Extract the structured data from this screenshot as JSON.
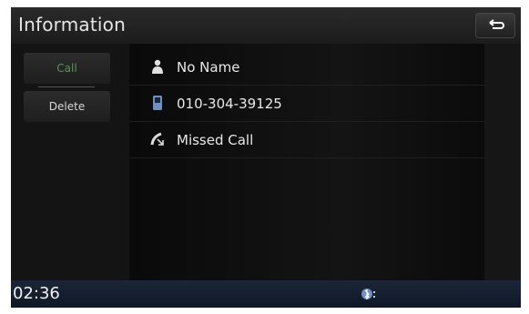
{
  "header": {
    "title": "Information",
    "back_icon": "back-arrow-icon"
  },
  "sidebar": {
    "call_label": "Call",
    "delete_label": "Delete"
  },
  "details": {
    "name": "No Name",
    "number": "010-304-39125",
    "status": "Missed Call",
    "icons": [
      "person-icon",
      "phone-icon",
      "missed-call-icon"
    ]
  },
  "status_bar": {
    "time": "02:36",
    "icon": "bluetooth-phone-icon"
  },
  "colors": {
    "call_text": "#5f8f5c",
    "status_bar": "#1b2638",
    "icon_blue": "#6f8fc0"
  }
}
